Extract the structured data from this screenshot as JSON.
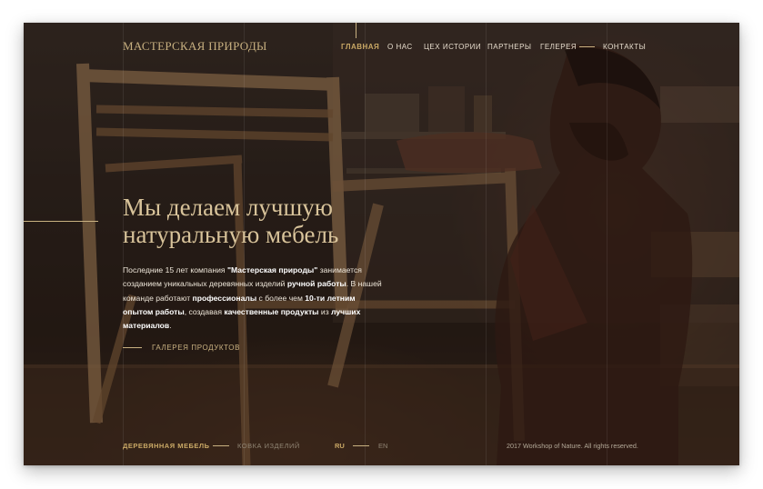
{
  "brand": {
    "logo": "МАСТЕРСКАЯ ПРИРОДЫ"
  },
  "nav": {
    "items": [
      {
        "label": "ГЛАВНАЯ",
        "active": true
      },
      {
        "label": "О НАС"
      },
      {
        "label": "ЦЕХ ИСТОРИИ"
      },
      {
        "label": "ПАРТНЕРЫ"
      },
      {
        "label": "ГЕЛЕРЕЯ"
      },
      {
        "label": "КОНТАКТЫ"
      }
    ]
  },
  "hero": {
    "headline_1": "Мы делаем лучшую",
    "headline_2": "натуральную мебель",
    "desc": {
      "t1": "Последние 15 лет компания ",
      "b1": "\"Мастерская природы\"",
      "t2": " занимается созданием уникальных деревянных изделий ",
      "b2": "ручной работы",
      "t3": ". В нашей команде работают ",
      "b3": "профессионалы",
      "t4": " с более чем ",
      "b4": "10-ти летним опытом работы",
      "t5": ", создавая ",
      "b5": "качественные продукты",
      "t6": " из ",
      "b6": "лучших материалов",
      "t7": "."
    },
    "cta": "ГАЛЕРЕЯ ПРОДУКТОВ"
  },
  "footer": {
    "link_1": "ДЕРЕВЯННАЯ МЕБЕЛЬ",
    "link_2": "КОВКА ИЗДЕЛИЙ",
    "lang_ru": "RU",
    "lang_en": "EN",
    "copyright": "2017 Workshop of Nature. All rights reserved."
  },
  "colors": {
    "accent": "#c9a865",
    "text_light": "#eee6d9",
    "background_dark": "#2e241e"
  },
  "icons": []
}
